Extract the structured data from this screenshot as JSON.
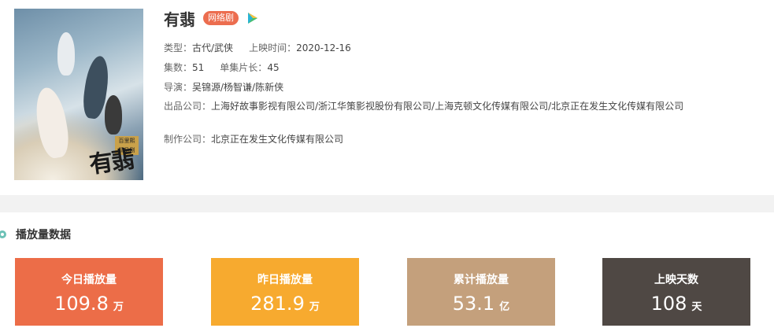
{
  "show": {
    "title": "有翡",
    "badge": "网络剧",
    "poster_tag": "百里熙\n精品剧",
    "poster_logo": "有翡",
    "type_label": "类型：",
    "type_value": "古代/武侠",
    "release_label": "上映时间：",
    "release_value": "2020-12-16",
    "episodes_label": "集数：",
    "episodes_value": "51",
    "duration_label": "单集片长：",
    "duration_value": "45",
    "director_label": "导演：",
    "director_value": "吴锦源/杨智谦/陈新侠",
    "producer_label": "出品公司：",
    "producer_value": "上海好故事影视有限公司/浙江华策影视股份有限公司/上海克顿文化传媒有限公司/北京正在发生文化传媒有限公司",
    "maker_label": "制作公司：",
    "maker_value": "北京正在发生文化传媒有限公司"
  },
  "section": {
    "title": "播放量数据"
  },
  "stats": [
    {
      "label": "今日播放量",
      "value": "109.8",
      "unit": "万"
    },
    {
      "label": "昨日播放量",
      "value": "281.9",
      "unit": "万"
    },
    {
      "label": "累计播放量",
      "value": "53.1",
      "unit": "亿"
    },
    {
      "label": "上映天数",
      "value": "108",
      "unit": "天"
    }
  ],
  "icons": {
    "play": "play-icon",
    "section": "circle-icon"
  },
  "colors": {
    "today": "#ec6d48",
    "yesterday": "#f7aa2f",
    "total": "#c4a07c",
    "days": "#4f4844",
    "badge": "#ec6d4f",
    "accent": "#6cc1b6"
  }
}
